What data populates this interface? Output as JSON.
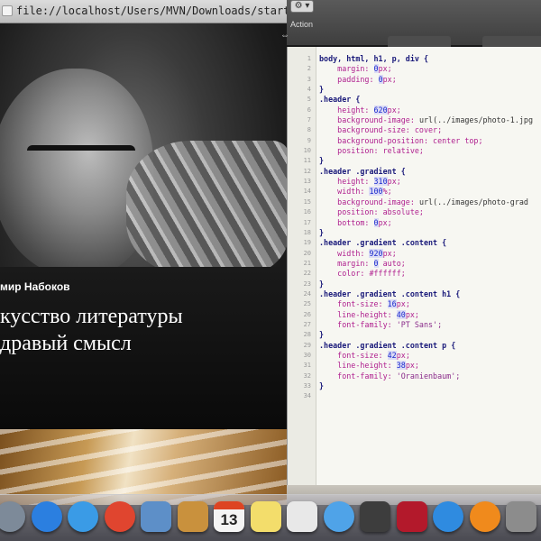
{
  "browser": {
    "url": "file://localhost/Users/MVN/Downloads/startKit-2/in"
  },
  "hero": {
    "author": "мир Набоков",
    "title_line1": "кусство литературы",
    "title_line2": "дравый смысл"
  },
  "editor": {
    "gear_label": "⚙ ▾",
    "action_label": "Action",
    "resize_handle": "⇔",
    "lines": [
      {
        "n": "1",
        "tokens": [
          {
            "t": "sel",
            "v": "body, html, h1, p, div {"
          }
        ]
      },
      {
        "n": "2",
        "tokens": [
          {
            "t": "prop",
            "v": "    margin: "
          },
          {
            "t": "num",
            "v": "0"
          },
          {
            "t": "prop",
            "v": "px;"
          }
        ]
      },
      {
        "n": "3",
        "tokens": [
          {
            "t": "prop",
            "v": "    padding: "
          },
          {
            "t": "num",
            "v": "0"
          },
          {
            "t": "prop",
            "v": "px;"
          }
        ]
      },
      {
        "n": "4",
        "tokens": [
          {
            "t": "sel",
            "v": "}"
          }
        ]
      },
      {
        "n": "5",
        "tokens": [
          {
            "t": "sel",
            "v": ".header {"
          }
        ]
      },
      {
        "n": "6",
        "tokens": [
          {
            "t": "prop",
            "v": "    height: "
          },
          {
            "t": "num",
            "v": "620"
          },
          {
            "t": "prop",
            "v": "px;"
          }
        ]
      },
      {
        "n": "7",
        "tokens": [
          {
            "t": "prop",
            "v": "    background-image: "
          },
          {
            "t": "plain",
            "v": "url(../images/photo-1.jpg"
          }
        ]
      },
      {
        "n": "8",
        "tokens": [
          {
            "t": "prop",
            "v": "    background-size: cover;"
          }
        ]
      },
      {
        "n": "9",
        "tokens": [
          {
            "t": "prop",
            "v": "    background-position: center top;"
          }
        ]
      },
      {
        "n": "10",
        "tokens": [
          {
            "t": "prop",
            "v": "    position: relative;"
          }
        ]
      },
      {
        "n": "11",
        "tokens": [
          {
            "t": "sel",
            "v": "}"
          }
        ]
      },
      {
        "n": "12",
        "tokens": [
          {
            "t": "sel",
            "v": ".header .gradient {"
          }
        ]
      },
      {
        "n": "13",
        "tokens": [
          {
            "t": "prop",
            "v": "    height: "
          },
          {
            "t": "num",
            "v": "310"
          },
          {
            "t": "prop",
            "v": "px;"
          }
        ]
      },
      {
        "n": "14",
        "tokens": [
          {
            "t": "prop",
            "v": "    width: "
          },
          {
            "t": "num",
            "v": "100"
          },
          {
            "t": "prop",
            "v": "%;"
          }
        ]
      },
      {
        "n": "15",
        "tokens": [
          {
            "t": "prop",
            "v": "    background-image: "
          },
          {
            "t": "plain",
            "v": "url(../images/photo-grad"
          }
        ]
      },
      {
        "n": "16",
        "tokens": [
          {
            "t": "prop",
            "v": "    position: absolute;"
          }
        ]
      },
      {
        "n": "17",
        "tokens": [
          {
            "t": "prop",
            "v": "    bottom: "
          },
          {
            "t": "num",
            "v": "0"
          },
          {
            "t": "prop",
            "v": "px;"
          }
        ]
      },
      {
        "n": "18",
        "tokens": [
          {
            "t": "sel",
            "v": "}"
          }
        ]
      },
      {
        "n": "19",
        "tokens": [
          {
            "t": "sel",
            "v": ".header .gradient .content {"
          }
        ]
      },
      {
        "n": "20",
        "tokens": [
          {
            "t": "prop",
            "v": "    width: "
          },
          {
            "t": "num",
            "v": "920"
          },
          {
            "t": "prop",
            "v": "px;"
          }
        ]
      },
      {
        "n": "21",
        "tokens": [
          {
            "t": "prop",
            "v": "    margin: "
          },
          {
            "t": "num",
            "v": "0"
          },
          {
            "t": "prop",
            "v": " auto;"
          }
        ]
      },
      {
        "n": "22",
        "tokens": [
          {
            "t": "prop",
            "v": "    color: #ffffff;"
          }
        ]
      },
      {
        "n": "23",
        "tokens": [
          {
            "t": "sel",
            "v": "}"
          }
        ]
      },
      {
        "n": "24",
        "tokens": [
          {
            "t": "sel",
            "v": ".header .gradient .content h1 {"
          }
        ]
      },
      {
        "n": "25",
        "tokens": [
          {
            "t": "prop",
            "v": "    font-size: "
          },
          {
            "t": "num",
            "v": "16"
          },
          {
            "t": "prop",
            "v": "px;"
          }
        ]
      },
      {
        "n": "26",
        "tokens": [
          {
            "t": "prop",
            "v": "    line-height: "
          },
          {
            "t": "num",
            "v": "40"
          },
          {
            "t": "prop",
            "v": "px;"
          }
        ]
      },
      {
        "n": "27",
        "tokens": [
          {
            "t": "prop",
            "v": "    font-family: "
          },
          {
            "t": "str",
            "v": "'PT Sans';"
          }
        ]
      },
      {
        "n": "28",
        "tokens": [
          {
            "t": "sel",
            "v": "}"
          }
        ]
      },
      {
        "n": "29",
        "tokens": [
          {
            "t": "sel",
            "v": ".header .gradient .content p {"
          }
        ]
      },
      {
        "n": "30",
        "tokens": [
          {
            "t": "prop",
            "v": "    font-size: "
          },
          {
            "t": "num",
            "v": "42"
          },
          {
            "t": "prop",
            "v": "px;"
          }
        ]
      },
      {
        "n": "31",
        "tokens": [
          {
            "t": "prop",
            "v": "    line-height: "
          },
          {
            "t": "num",
            "v": "38"
          },
          {
            "t": "prop",
            "v": "px;"
          }
        ]
      },
      {
        "n": "32",
        "tokens": [
          {
            "t": "prop",
            "v": "    font-family: "
          },
          {
            "t": "str",
            "v": "'Oranienbaum';"
          }
        ]
      },
      {
        "n": "33",
        "tokens": [
          {
            "t": "sel",
            "v": "}"
          }
        ]
      },
      {
        "n": "34",
        "tokens": []
      }
    ]
  },
  "dock": {
    "calendar_day": "13",
    "icons": [
      {
        "name": "launchpad-icon",
        "color": "#7d8a99",
        "round": true
      },
      {
        "name": "app-store-icon",
        "color": "#2b7fe0",
        "round": true
      },
      {
        "name": "safari-icon",
        "color": "#3a9be6",
        "round": true
      },
      {
        "name": "chrome-icon",
        "color": "#e0452f",
        "round": true
      },
      {
        "name": "mail-icon",
        "color": "#5d8fc8",
        "round": false
      },
      {
        "name": "address-book-icon",
        "color": "#c9913d",
        "round": false
      },
      {
        "name": "calendar-icon",
        "color": "#f4f4f4",
        "round": false
      },
      {
        "name": "notes-icon",
        "color": "#f3dd6b",
        "round": false
      },
      {
        "name": "text-editor-icon",
        "color": "#e8e8e8",
        "round": false
      },
      {
        "name": "messages-icon",
        "color": "#4fa3e8",
        "round": true
      },
      {
        "name": "facetime-icon",
        "color": "#3d3d3d",
        "round": false
      },
      {
        "name": "photo-booth-icon",
        "color": "#b3192b",
        "round": false
      },
      {
        "name": "itunes-icon",
        "color": "#2f8be0",
        "round": true
      },
      {
        "name": "ibooks-icon",
        "color": "#f08a1c",
        "round": true
      },
      {
        "name": "system-prefs-icon",
        "color": "#8c8c8c",
        "round": false
      }
    ]
  },
  "colors": {
    "editor_bg": "#f7f7f2",
    "selector": "#1a1a7a",
    "property": "#b0208f",
    "number": "#1a2acd"
  }
}
